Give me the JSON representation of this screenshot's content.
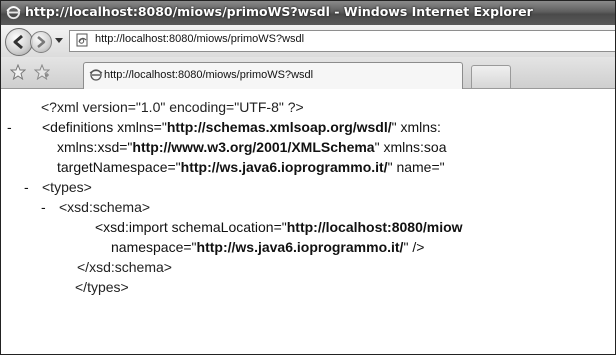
{
  "window": {
    "title": "http://localhost:8080/miows/primoWS?wsdl - Windows Internet Explorer"
  },
  "addressbar": {
    "url": "http://localhost:8080/miows/primoWS?wsdl"
  },
  "tabs": [
    {
      "label": "http://localhost:8080/miows/primoWS?wsdl"
    }
  ],
  "icons": [
    "ie-logo-icon",
    "back-arrow-icon",
    "forward-arrow-icon",
    "page-icon",
    "favorites-star-icon",
    "add-favorites-icon"
  ],
  "content": {
    "lines": [
      {
        "toggle": "",
        "text": "<?xml version=\"1.0\" encoding=\"UTF-8\" ?>"
      },
      {
        "toggle": "-",
        "pre": "<definitions xmlns=\"",
        "val": "http://schemas.xmlsoap.org/wsdl/",
        "post": "\" xmlns:"
      },
      {
        "toggle": "",
        "pre": "xmlns:xsd=\"",
        "val": "http://www.w3.org/2001/XMLSchema",
        "post": "\" xmlns:soa"
      },
      {
        "toggle": "",
        "pre": "targetNamespace=\"",
        "val": "http://ws.java6.ioprogrammo.it/",
        "post": "\" name=\""
      },
      {
        "toggle": "-",
        "text": "<types>"
      },
      {
        "toggle": "-",
        "text": "<xsd:schema>"
      },
      {
        "toggle": "",
        "pre": "<xsd:import schemaLocation=\"",
        "val": "http://localhost:8080/miow",
        "post": ""
      },
      {
        "toggle": "",
        "pre": "namespace=\"",
        "val": "http://ws.java6.ioprogrammo.it/",
        "post": "\" />"
      },
      {
        "toggle": "",
        "text": "</xsd:schema>"
      },
      {
        "toggle": "",
        "text": "</types>"
      }
    ]
  }
}
